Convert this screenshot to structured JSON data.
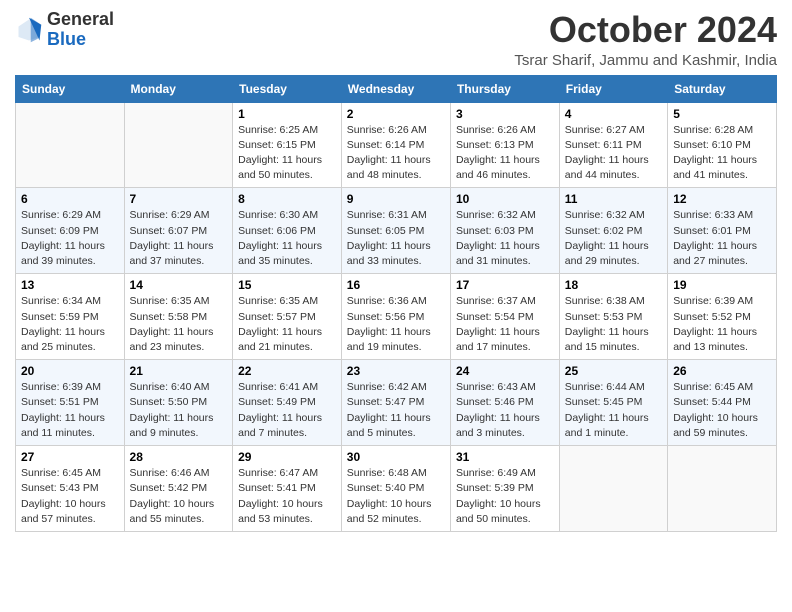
{
  "header": {
    "logo_general": "General",
    "logo_blue": "Blue",
    "month_title": "October 2024",
    "location": "Tsrar Sharif, Jammu and Kashmir, India"
  },
  "days_of_week": [
    "Sunday",
    "Monday",
    "Tuesday",
    "Wednesday",
    "Thursday",
    "Friday",
    "Saturday"
  ],
  "weeks": [
    [
      {
        "day": "",
        "info": ""
      },
      {
        "day": "",
        "info": ""
      },
      {
        "day": "1",
        "info": "Sunrise: 6:25 AM\nSunset: 6:15 PM\nDaylight: 11 hours and 50 minutes."
      },
      {
        "day": "2",
        "info": "Sunrise: 6:26 AM\nSunset: 6:14 PM\nDaylight: 11 hours and 48 minutes."
      },
      {
        "day": "3",
        "info": "Sunrise: 6:26 AM\nSunset: 6:13 PM\nDaylight: 11 hours and 46 minutes."
      },
      {
        "day": "4",
        "info": "Sunrise: 6:27 AM\nSunset: 6:11 PM\nDaylight: 11 hours and 44 minutes."
      },
      {
        "day": "5",
        "info": "Sunrise: 6:28 AM\nSunset: 6:10 PM\nDaylight: 11 hours and 41 minutes."
      }
    ],
    [
      {
        "day": "6",
        "info": "Sunrise: 6:29 AM\nSunset: 6:09 PM\nDaylight: 11 hours and 39 minutes."
      },
      {
        "day": "7",
        "info": "Sunrise: 6:29 AM\nSunset: 6:07 PM\nDaylight: 11 hours and 37 minutes."
      },
      {
        "day": "8",
        "info": "Sunrise: 6:30 AM\nSunset: 6:06 PM\nDaylight: 11 hours and 35 minutes."
      },
      {
        "day": "9",
        "info": "Sunrise: 6:31 AM\nSunset: 6:05 PM\nDaylight: 11 hours and 33 minutes."
      },
      {
        "day": "10",
        "info": "Sunrise: 6:32 AM\nSunset: 6:03 PM\nDaylight: 11 hours and 31 minutes."
      },
      {
        "day": "11",
        "info": "Sunrise: 6:32 AM\nSunset: 6:02 PM\nDaylight: 11 hours and 29 minutes."
      },
      {
        "day": "12",
        "info": "Sunrise: 6:33 AM\nSunset: 6:01 PM\nDaylight: 11 hours and 27 minutes."
      }
    ],
    [
      {
        "day": "13",
        "info": "Sunrise: 6:34 AM\nSunset: 5:59 PM\nDaylight: 11 hours and 25 minutes."
      },
      {
        "day": "14",
        "info": "Sunrise: 6:35 AM\nSunset: 5:58 PM\nDaylight: 11 hours and 23 minutes."
      },
      {
        "day": "15",
        "info": "Sunrise: 6:35 AM\nSunset: 5:57 PM\nDaylight: 11 hours and 21 minutes."
      },
      {
        "day": "16",
        "info": "Sunrise: 6:36 AM\nSunset: 5:56 PM\nDaylight: 11 hours and 19 minutes."
      },
      {
        "day": "17",
        "info": "Sunrise: 6:37 AM\nSunset: 5:54 PM\nDaylight: 11 hours and 17 minutes."
      },
      {
        "day": "18",
        "info": "Sunrise: 6:38 AM\nSunset: 5:53 PM\nDaylight: 11 hours and 15 minutes."
      },
      {
        "day": "19",
        "info": "Sunrise: 6:39 AM\nSunset: 5:52 PM\nDaylight: 11 hours and 13 minutes."
      }
    ],
    [
      {
        "day": "20",
        "info": "Sunrise: 6:39 AM\nSunset: 5:51 PM\nDaylight: 11 hours and 11 minutes."
      },
      {
        "day": "21",
        "info": "Sunrise: 6:40 AM\nSunset: 5:50 PM\nDaylight: 11 hours and 9 minutes."
      },
      {
        "day": "22",
        "info": "Sunrise: 6:41 AM\nSunset: 5:49 PM\nDaylight: 11 hours and 7 minutes."
      },
      {
        "day": "23",
        "info": "Sunrise: 6:42 AM\nSunset: 5:47 PM\nDaylight: 11 hours and 5 minutes."
      },
      {
        "day": "24",
        "info": "Sunrise: 6:43 AM\nSunset: 5:46 PM\nDaylight: 11 hours and 3 minutes."
      },
      {
        "day": "25",
        "info": "Sunrise: 6:44 AM\nSunset: 5:45 PM\nDaylight: 11 hours and 1 minute."
      },
      {
        "day": "26",
        "info": "Sunrise: 6:45 AM\nSunset: 5:44 PM\nDaylight: 10 hours and 59 minutes."
      }
    ],
    [
      {
        "day": "27",
        "info": "Sunrise: 6:45 AM\nSunset: 5:43 PM\nDaylight: 10 hours and 57 minutes."
      },
      {
        "day": "28",
        "info": "Sunrise: 6:46 AM\nSunset: 5:42 PM\nDaylight: 10 hours and 55 minutes."
      },
      {
        "day": "29",
        "info": "Sunrise: 6:47 AM\nSunset: 5:41 PM\nDaylight: 10 hours and 53 minutes."
      },
      {
        "day": "30",
        "info": "Sunrise: 6:48 AM\nSunset: 5:40 PM\nDaylight: 10 hours and 52 minutes."
      },
      {
        "day": "31",
        "info": "Sunrise: 6:49 AM\nSunset: 5:39 PM\nDaylight: 10 hours and 50 minutes."
      },
      {
        "day": "",
        "info": ""
      },
      {
        "day": "",
        "info": ""
      }
    ]
  ]
}
